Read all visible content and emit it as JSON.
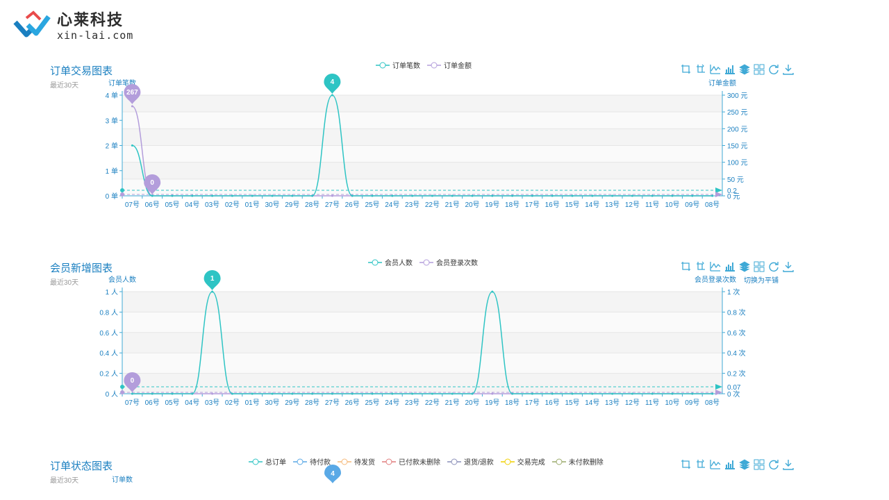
{
  "logo": {
    "name": "心莱科技",
    "url": "xin-lai.com"
  },
  "colors": {
    "teal": "#2ec4c4",
    "purple": "#b39ddb",
    "blue": "#3fa9d6",
    "axis": "#1a7fc0"
  },
  "toolbox_icons": [
    "zoom-icon",
    "zoom-reset-icon",
    "line-chart-icon",
    "bar-chart-icon",
    "stack-icon",
    "tiled-icon",
    "restore-icon",
    "download-icon"
  ],
  "x_dates": [
    "07号",
    "06号",
    "05号",
    "04号",
    "03号",
    "02号",
    "01号",
    "30号",
    "29号",
    "28号",
    "27号",
    "26号",
    "25号",
    "24号",
    "23号",
    "22号",
    "21号",
    "20号",
    "19号",
    "18号",
    "17号",
    "16号",
    "15号",
    "14号",
    "13号",
    "12号",
    "11号",
    "10号",
    "09号",
    "08号"
  ],
  "orders": {
    "title": "订单交易图表",
    "subtitle": "最近30天",
    "legend": [
      "订单笔数",
      "订单金额"
    ],
    "left_axis_name": "订单笔数",
    "right_axis_name": "订单金额",
    "left_ticks": [
      "0 单",
      "1 单",
      "2 单",
      "3 单",
      "4 单"
    ],
    "right_ticks": [
      "0 元",
      "50 元",
      "100 元",
      "150 元",
      "200 元",
      "250 元",
      "300 元"
    ],
    "avg_label": "0.2",
    "markers": {
      "max_left": "4",
      "max_right": "267",
      "min_right": "0"
    }
  },
  "members": {
    "title": "会员新增图表",
    "subtitle": "最近30天",
    "legend": [
      "会员人数",
      "会员登录次数"
    ],
    "left_axis_name": "会员人数",
    "right_axis_name": "会员登录次数",
    "tooltip": "切换为平铺",
    "left_ticks": [
      "0 人",
      "0.2 人",
      "0.4 人",
      "0.6 人",
      "0.8 人",
      "1 人"
    ],
    "right_ticks": [
      "0 次",
      "0.2 次",
      "0.4 次",
      "0.6 次",
      "0.8 次",
      "1 次"
    ],
    "avg_label": "0.07",
    "markers": {
      "max_left": "1",
      "min_right": "0"
    }
  },
  "status": {
    "title": "订单状态图表",
    "subtitle": "最近30天",
    "legend": [
      {
        "name": "总订单",
        "color": "#2ec4c4"
      },
      {
        "name": "待付款",
        "color": "#5aa9e6"
      },
      {
        "name": "待发货",
        "color": "#f5b97a"
      },
      {
        "name": "已付款未删除",
        "color": "#e07b7b"
      },
      {
        "name": "退货/退款",
        "color": "#8a8fb8"
      },
      {
        "name": "交易完成",
        "color": "#f0d000"
      },
      {
        "name": "未付款删除",
        "color": "#9aaa6a"
      }
    ],
    "left_axis_name": "订单数",
    "marker": "4"
  },
  "chart_data": [
    {
      "type": "line",
      "title": "订单交易图表",
      "categories": [
        "07号",
        "06号",
        "05号",
        "04号",
        "03号",
        "02号",
        "01号",
        "30号",
        "29号",
        "28号",
        "27号",
        "26号",
        "25号",
        "24号",
        "23号",
        "22号",
        "21号",
        "20号",
        "19号",
        "18号",
        "17号",
        "16号",
        "15号",
        "14号",
        "13号",
        "12号",
        "11号",
        "10号",
        "09号",
        "08号"
      ],
      "series": [
        {
          "name": "订单笔数",
          "axis": "left",
          "values": [
            2,
            0,
            0,
            0,
            0,
            0,
            0,
            0,
            0,
            0,
            4,
            0,
            0,
            0,
            0,
            0,
            0,
            0,
            0,
            0,
            0,
            0,
            0,
            0,
            0,
            0,
            0,
            0,
            0,
            0
          ]
        },
        {
          "name": "订单金额",
          "axis": "right",
          "values": [
            267,
            0,
            0,
            0,
            0,
            0,
            0,
            0,
            0,
            0,
            0,
            0,
            0,
            0,
            0,
            0,
            0,
            0,
            0,
            0,
            0,
            0,
            0,
            0,
            0,
            0,
            0,
            0,
            0,
            0
          ]
        }
      ],
      "ylim_left": [
        0,
        4
      ],
      "ylim_right": [
        0,
        300
      ],
      "grid": true,
      "legend": "top-center"
    },
    {
      "type": "line",
      "title": "会员新增图表",
      "categories": [
        "07号",
        "06号",
        "05号",
        "04号",
        "03号",
        "02号",
        "01号",
        "30号",
        "29号",
        "28号",
        "27号",
        "26号",
        "25号",
        "24号",
        "23号",
        "22号",
        "21号",
        "20号",
        "19号",
        "18号",
        "17号",
        "16号",
        "15号",
        "14号",
        "13号",
        "12号",
        "11号",
        "10号",
        "09号",
        "08号"
      ],
      "series": [
        {
          "name": "会员人数",
          "axis": "left",
          "values": [
            0,
            0,
            0,
            0,
            1,
            0,
            0,
            0,
            0,
            0,
            0,
            0,
            0,
            0,
            0,
            0,
            0,
            0,
            1,
            0,
            0,
            0,
            0,
            0,
            0,
            0,
            0,
            0,
            0,
            0
          ]
        },
        {
          "name": "会员登录次数",
          "axis": "right",
          "values": [
            0,
            0,
            0,
            0,
            0,
            0,
            0,
            0,
            0,
            0,
            0,
            0,
            0,
            0,
            0,
            0,
            0,
            0,
            0,
            0,
            0,
            0,
            0,
            0,
            0,
            0,
            0,
            0,
            0,
            0
          ]
        }
      ],
      "ylim_left": [
        0,
        1
      ],
      "ylim_right": [
        0,
        1
      ],
      "grid": true,
      "legend": "top-center"
    }
  ]
}
